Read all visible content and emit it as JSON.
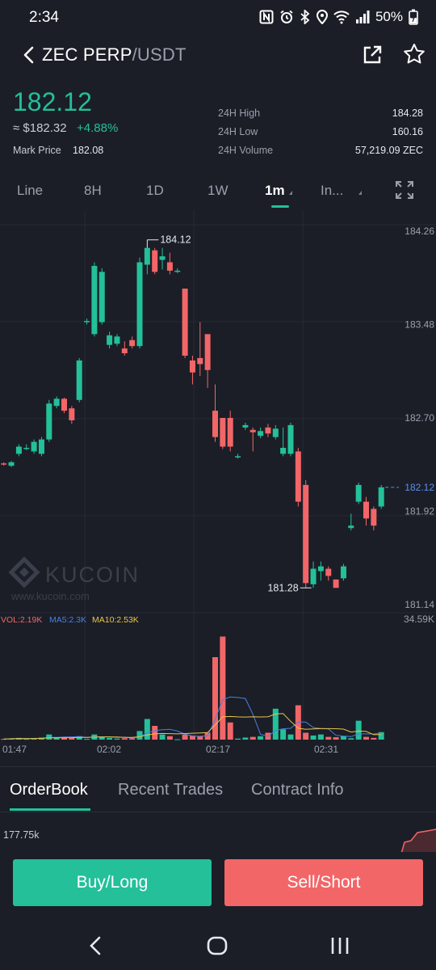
{
  "status_bar": {
    "time": "2:34",
    "battery": "50%"
  },
  "header": {
    "base": "ZEC PERP",
    "quote": "/USDT"
  },
  "ticker": {
    "last_price": "182.12",
    "approx_fiat": "≈ $182.32",
    "change_pct": "+4.88%",
    "mark_label": "Mark Price",
    "mark_value": "182.08",
    "high_label": "24H High",
    "high_value": "184.28",
    "low_label": "24H Low",
    "low_value": "160.16",
    "volume_label": "24H Volume",
    "volume_value": "57,219.09 ZEC"
  },
  "timeframes": [
    {
      "label": "Line",
      "active": false
    },
    {
      "label": "8H",
      "active": false
    },
    {
      "label": "1D",
      "active": false
    },
    {
      "label": "1W",
      "active": false
    },
    {
      "label": "1m",
      "active": true
    },
    {
      "label": "In...",
      "active": false
    }
  ],
  "watermark": {
    "brand": "KUCOIN",
    "url": "www.kucoin.com"
  },
  "colors": {
    "up": "#23c09a",
    "down": "#f26668",
    "bg": "#1b1e27",
    "ma5": "#4a7ee0",
    "ma10": "#e8c547"
  },
  "chart_data": {
    "type": "candlestick",
    "price_axis_labels": [
      "184.26",
      "183.48",
      "182.70",
      "182.12",
      "181.92",
      "181.14"
    ],
    "price_range": [
      181.14,
      184.26
    ],
    "current_price_label": "182.12",
    "high_marker": "184.12",
    "low_marker": "181.28",
    "time_labels": [
      "01:47",
      "02:02",
      "02:17",
      "02:31"
    ],
    "volume_legend": {
      "vol": "VOL:2.19K",
      "ma5": "MA5:2.3K",
      "ma10": "MA10:2.53K"
    },
    "volume_axis_max": "34.59K",
    "candles": [
      {
        "o": 182.32,
        "h": 182.33,
        "l": 182.3,
        "c": 182.31,
        "v": 0.2
      },
      {
        "o": 182.3,
        "h": 182.34,
        "l": 182.29,
        "c": 182.33,
        "v": 0.3
      },
      {
        "o": 182.4,
        "h": 182.48,
        "l": 182.38,
        "c": 182.46,
        "v": 0.5
      },
      {
        "o": 182.45,
        "h": 182.48,
        "l": 182.43,
        "c": 182.45,
        "v": 0.2
      },
      {
        "o": 182.42,
        "h": 182.52,
        "l": 182.4,
        "c": 182.5,
        "v": 0.4
      },
      {
        "o": 182.4,
        "h": 182.54,
        "l": 182.38,
        "c": 182.52,
        "v": 0.6
      },
      {
        "o": 182.52,
        "h": 182.85,
        "l": 182.5,
        "c": 182.82,
        "v": 1.5
      },
      {
        "o": 182.8,
        "h": 182.88,
        "l": 182.78,
        "c": 182.86,
        "v": 0.5
      },
      {
        "o": 182.86,
        "h": 182.87,
        "l": 182.74,
        "c": 182.76,
        "v": 0.8
      },
      {
        "o": 182.78,
        "h": 182.8,
        "l": 182.65,
        "c": 182.68,
        "v": 0.6
      },
      {
        "o": 182.85,
        "h": 183.2,
        "l": 182.83,
        "c": 183.18,
        "v": 1.0
      },
      {
        "o": 183.5,
        "h": 183.53,
        "l": 183.48,
        "c": 183.51,
        "v": 0.2
      },
      {
        "o": 183.4,
        "h": 184.0,
        "l": 183.38,
        "c": 183.97,
        "v": 1.5
      },
      {
        "o": 183.5,
        "h": 183.95,
        "l": 183.48,
        "c": 183.92,
        "v": 0.8
      },
      {
        "o": 183.31,
        "h": 183.42,
        "l": 183.28,
        "c": 183.39,
        "v": 0.5
      },
      {
        "o": 183.32,
        "h": 183.4,
        "l": 183.3,
        "c": 183.38,
        "v": 0.3
      },
      {
        "o": 183.28,
        "h": 183.34,
        "l": 183.22,
        "c": 183.24,
        "v": 0.4
      },
      {
        "o": 183.35,
        "h": 183.38,
        "l": 183.28,
        "c": 183.3,
        "v": 0.4
      },
      {
        "o": 183.3,
        "h": 184.04,
        "l": 183.28,
        "c": 184.0,
        "v": 2.5
      },
      {
        "o": 183.98,
        "h": 184.12,
        "l": 183.9,
        "c": 184.12,
        "v": 6.0
      },
      {
        "o": 184.1,
        "h": 184.12,
        "l": 183.9,
        "c": 183.92,
        "v": 4.0
      },
      {
        "o": 184.02,
        "h": 184.12,
        "l": 183.94,
        "c": 184.05,
        "v": 1.5
      },
      {
        "o": 184.0,
        "h": 184.08,
        "l": 183.9,
        "c": 183.93,
        "v": 1.0
      },
      {
        "o": 183.92,
        "h": 183.95,
        "l": 183.91,
        "c": 183.93,
        "v": 0.1
      },
      {
        "o": 183.78,
        "h": 183.78,
        "l": 183.2,
        "c": 183.22,
        "v": 1.5
      },
      {
        "o": 183.18,
        "h": 183.22,
        "l": 182.98,
        "c": 183.08,
        "v": 1.2
      },
      {
        "o": 183.2,
        "h": 183.5,
        "l": 183.05,
        "c": 183.15,
        "v": 1.0
      },
      {
        "o": 183.4,
        "h": 183.4,
        "l": 182.95,
        "c": 183.1,
        "v": 2.0
      },
      {
        "o": 182.76,
        "h": 182.98,
        "l": 182.5,
        "c": 182.54,
        "v": 24.0
      },
      {
        "o": 182.7,
        "h": 182.7,
        "l": 182.44,
        "c": 182.46,
        "v": 30.0
      },
      {
        "o": 182.7,
        "h": 182.76,
        "l": 182.42,
        "c": 182.46,
        "v": 5.0
      },
      {
        "o": 182.38,
        "h": 182.4,
        "l": 182.36,
        "c": 182.38,
        "v": 0.3
      },
      {
        "o": 182.62,
        "h": 182.66,
        "l": 182.6,
        "c": 182.64,
        "v": 0.6
      },
      {
        "o": 182.6,
        "h": 182.62,
        "l": 182.42,
        "c": 182.58,
        "v": 0.8
      },
      {
        "o": 182.55,
        "h": 182.62,
        "l": 182.53,
        "c": 182.59,
        "v": 1.0
      },
      {
        "o": 182.62,
        "h": 182.65,
        "l": 182.54,
        "c": 182.57,
        "v": 2.0
      },
      {
        "o": 182.54,
        "h": 182.64,
        "l": 182.52,
        "c": 182.61,
        "v": 9.0
      },
      {
        "o": 182.4,
        "h": 182.62,
        "l": 182.38,
        "c": 182.45,
        "v": 3.0
      },
      {
        "o": 182.4,
        "h": 182.66,
        "l": 182.38,
        "c": 182.64,
        "v": 1.5
      },
      {
        "o": 182.42,
        "h": 182.45,
        "l": 181.96,
        "c": 182.0,
        "v": 10.0
      },
      {
        "o": 182.14,
        "h": 182.18,
        "l": 181.28,
        "c": 181.32,
        "v": 2.0
      },
      {
        "o": 181.31,
        "h": 181.5,
        "l": 181.28,
        "c": 181.44,
        "v": 1.2
      },
      {
        "o": 181.42,
        "h": 181.5,
        "l": 181.34,
        "c": 181.46,
        "v": 1.5
      },
      {
        "o": 181.44,
        "h": 181.46,
        "l": 181.34,
        "c": 181.38,
        "v": 0.8
      },
      {
        "o": 181.35,
        "h": 181.35,
        "l": 181.28,
        "c": 181.28,
        "v": 0.7
      },
      {
        "o": 181.36,
        "h": 181.48,
        "l": 181.34,
        "c": 181.46,
        "v": 1.0
      },
      {
        "o": 181.78,
        "h": 181.9,
        "l": 181.76,
        "c": 181.8,
        "v": 0.4
      },
      {
        "o": 182.0,
        "h": 182.16,
        "l": 181.98,
        "c": 182.14,
        "v": 5.5
      },
      {
        "o": 182.0,
        "h": 182.04,
        "l": 181.8,
        "c": 181.86,
        "v": 0.8
      },
      {
        "o": 181.94,
        "h": 181.96,
        "l": 181.76,
        "c": 181.8,
        "v": 0.5
      },
      {
        "o": 181.96,
        "h": 182.14,
        "l": 181.94,
        "c": 182.12,
        "v": 2.19
      }
    ]
  },
  "lower_tabs": [
    {
      "label": "OrderBook",
      "active": true
    },
    {
      "label": "Recent Trades",
      "active": false
    },
    {
      "label": "Contract Info",
      "active": false
    }
  ],
  "orderbook": {
    "depth_value": "177.75k"
  },
  "actions": {
    "buy_label": "Buy/Long",
    "sell_label": "Sell/Short"
  }
}
